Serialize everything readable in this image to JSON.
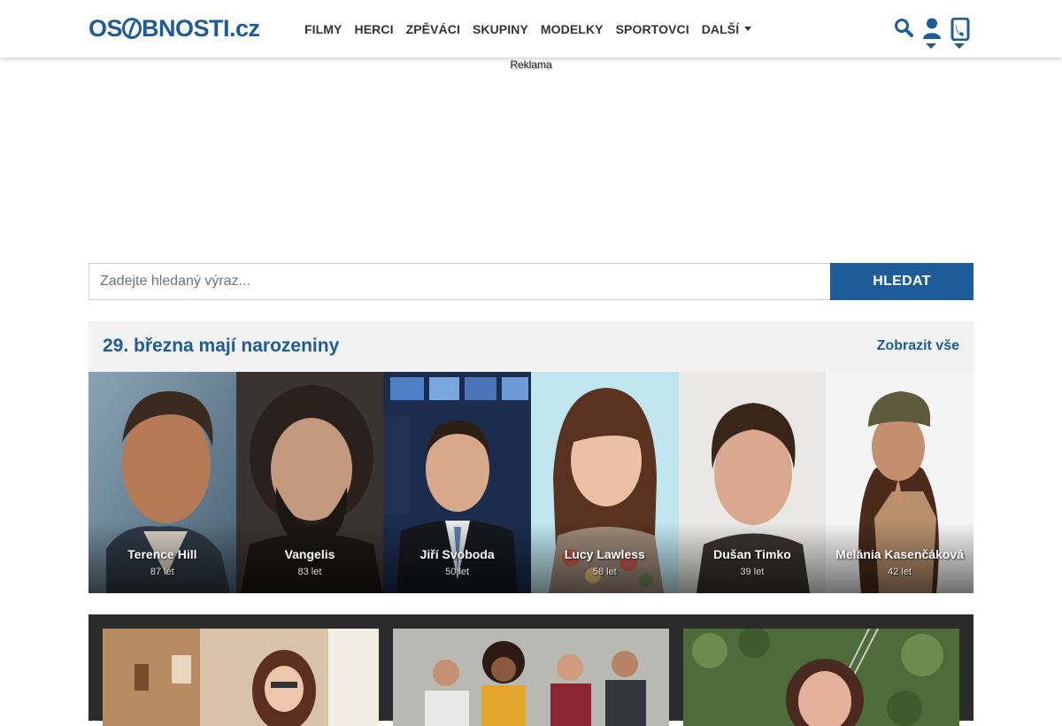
{
  "brand": {
    "name_prefix": "OS",
    "name_suffix": "BNOSTI",
    "tld": ".cz"
  },
  "nav": {
    "items": [
      {
        "label": "FILMY"
      },
      {
        "label": "HERCI"
      },
      {
        "label": "ZPĚVÁCI"
      },
      {
        "label": "SKUPINY"
      },
      {
        "label": "MODELKY"
      },
      {
        "label": "SPORTOVCI"
      },
      {
        "label": "DALŠÍ"
      }
    ],
    "icons": [
      "search-icon",
      "user-icon",
      "phone-icon"
    ]
  },
  "ad": {
    "label": "Reklama"
  },
  "search": {
    "placeholder": "Zadejte hledaný výraz...",
    "button_label": "HLEDAT"
  },
  "birthdays": {
    "title": "29. března mají narozeniny",
    "show_all": "Zobrazit vše",
    "people": [
      {
        "name": "Terence Hill",
        "age": "87 let"
      },
      {
        "name": "Vangelis",
        "age": "83 let"
      },
      {
        "name": "Jiří Svoboda",
        "age": "50 let"
      },
      {
        "name": "Lucy Lawless",
        "age": "58 let"
      },
      {
        "name": "Dušan Timko",
        "age": "39 let"
      },
      {
        "name": "Melánia Kasenčáková",
        "age": "42 let"
      }
    ]
  },
  "colors": {
    "brand": "#1d5c99",
    "panel": "#f2f2f2",
    "dark_panel": "#2b2b2b"
  }
}
